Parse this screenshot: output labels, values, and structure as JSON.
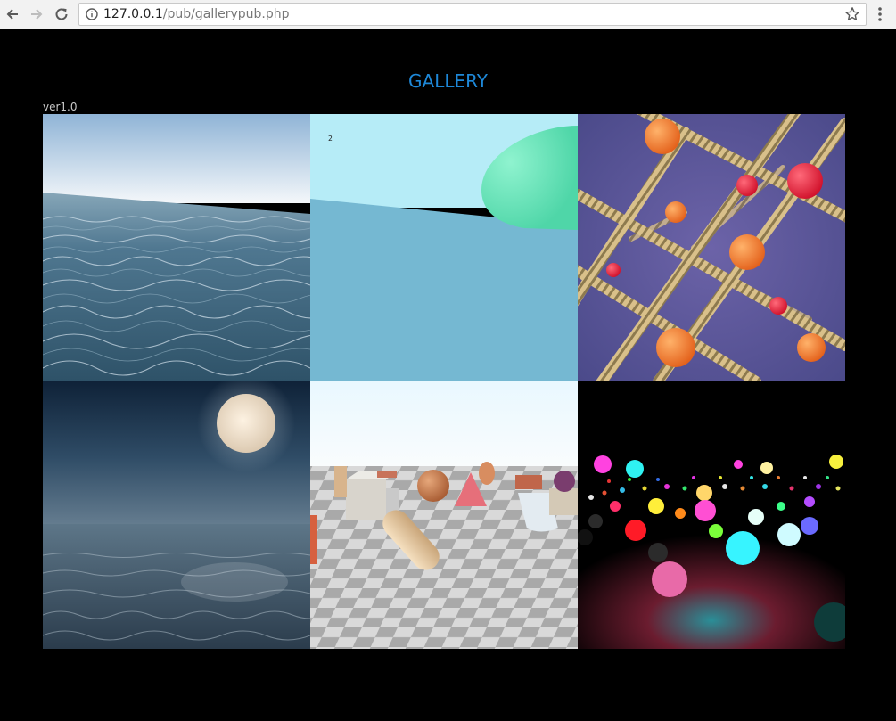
{
  "browser": {
    "url_host": "127.0.0.1",
    "url_path": "/pub/gallerypub.php",
    "icons": {
      "back": "back-arrow-icon",
      "forward": "forward-arrow-icon",
      "reload": "reload-icon",
      "info": "info-icon",
      "bookmark": "star-icon",
      "menu": "more-vert-icon"
    }
  },
  "page": {
    "title": "GALLERY",
    "version": "ver1.0",
    "colors": {
      "title": "#1e88d8",
      "background": "#000000"
    }
  },
  "gallery": {
    "tiles": [
      {
        "name": "ocean-waves"
      },
      {
        "name": "pastel-dome",
        "overlay_text": "2"
      },
      {
        "name": "helix-lattice"
      },
      {
        "name": "moonlit-sea"
      },
      {
        "name": "primitives-checkerboard"
      },
      {
        "name": "neon-spheres"
      }
    ]
  }
}
